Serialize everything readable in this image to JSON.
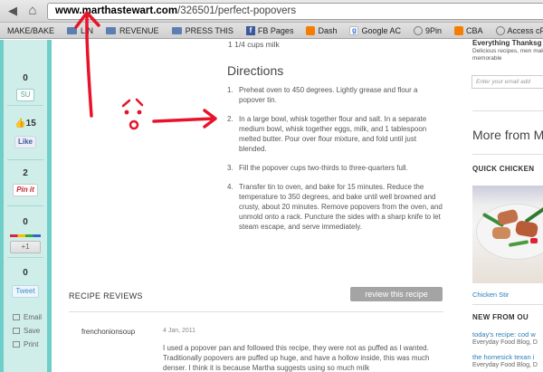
{
  "browser": {
    "url_host": "www.marthastewart.com",
    "url_path": "/326501/perfect-popovers",
    "back_glyph": "◀",
    "home_glyph": "⌂"
  },
  "bookmarks": [
    {
      "label": "MAKE/BAKE",
      "icon": "none"
    },
    {
      "label": "LIN",
      "icon": "folder-icon"
    },
    {
      "label": "REVENUE",
      "icon": "folder-icon"
    },
    {
      "label": "PRESS THIS",
      "icon": "folder-icon"
    },
    {
      "label": "FB Pages",
      "icon": "facebook-icon"
    },
    {
      "label": "Dash",
      "icon": "blogger-icon"
    },
    {
      "label": "Google AC",
      "icon": "google-icon"
    },
    {
      "label": "9Pin",
      "icon": "circle-icon"
    },
    {
      "label": "CBA",
      "icon": "blogger-icon"
    },
    {
      "label": "Access cPanel Webm",
      "icon": "circle-icon"
    }
  ],
  "share": {
    "stumble": {
      "count": "0",
      "label": "SU"
    },
    "facebook": {
      "count": "15",
      "label": "Like"
    },
    "pinterest": {
      "count": "2",
      "label": "Pin it"
    },
    "gplus": {
      "count": "0",
      "label": "+1"
    },
    "twitter": {
      "count": "0",
      "label": "Tweet"
    },
    "tools": [
      "Email",
      "Save",
      "Print"
    ]
  },
  "recipe": {
    "ingredient_tail": "1 1/4 cups milk",
    "directions_heading": "Directions",
    "steps": [
      "Preheat oven to 450 degrees. Lightly grease and flour a popover tin.",
      "In a large bowl, whisk together flour and salt. In a separate medium bowl, whisk together eggs, milk, and 1 tablespoon melted butter. Pour over flour mixture, and fold until just blended.",
      "Fill the popover cups two-thirds to three-quarters full.",
      "Transfer tin to oven, and bake for 15 minutes. Reduce the temperature to 350 degrees, and bake until well browned and crusty, about 20 minutes. Remove popovers from the oven, and unmold onto a rack. Puncture the sides with a sharp knife to let steam escape, and serve immediately."
    ]
  },
  "reviews": {
    "title": "RECIPE REVIEWS",
    "button": "review this recipe",
    "items": [
      {
        "author": "frenchonionsoup",
        "date": "4 Jan, 2011",
        "text": "I used a popover pan and followed this recipe, they were not as puffed as I wanted. Traditionally popovers are puffed up huge, and have a hollow inside, this was much denser. I think it is because Martha suggests using so much milk"
      }
    ]
  },
  "sidebar": {
    "promo_title": "Everything Thanksg",
    "promo_text": "Delicious recipes, men make this a memorable",
    "email_placeholder": "Enter your email add",
    "more_from": "More from M",
    "quick_title": "QUICK CHICKEN",
    "quick_link": "Chicken Stir",
    "new_from": "NEW FROM OU",
    "news": [
      {
        "link": "today's recipe: cod w",
        "source": "Everyday Food Blog, D"
      },
      {
        "link": "the homesick texan i",
        "source": "Everyday Food Blog, D"
      }
    ]
  },
  "annotation_color": "#e8132a"
}
